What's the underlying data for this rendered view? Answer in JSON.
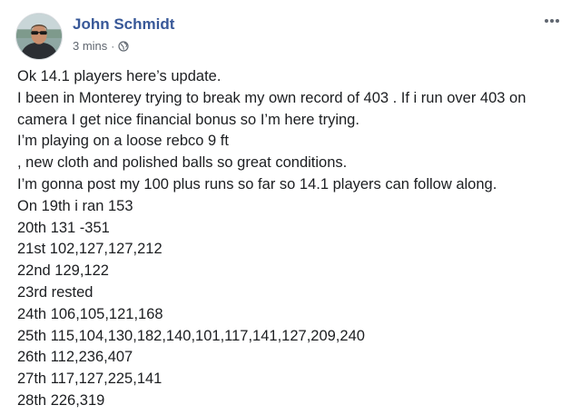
{
  "post": {
    "author": "John Schmidt",
    "time": "3 mins",
    "separator": "·",
    "privacy_icon": "globe-icon",
    "more_icon": "more-options-icon",
    "lines": [
      "Ok 14.1 players here’s update.",
      "I been in Monterey trying to break my own record of 403 . If i run over 403 on camera I get nice financial bonus so I’m here trying.",
      "I’m playing on a loose rebco 9 ft",
      ", new cloth and polished balls so great conditions.",
      "I’m gonna post my 100 plus runs so far so 14.1 players can follow along.",
      "On 19th i ran 153",
      "20th 131 -351",
      "21st 102,127,127,212",
      "22nd 129,122",
      "23rd rested",
      "24th 106,105,121,168",
      "25th 115,104,130,182,140,101,117,141,127,209,240",
      "26th 112,236,407",
      "27th 117,127,225,141",
      "28th 226,319"
    ]
  },
  "colors": {
    "author_link": "#385898",
    "meta_text": "#606770",
    "body_text": "#1c1e21"
  }
}
